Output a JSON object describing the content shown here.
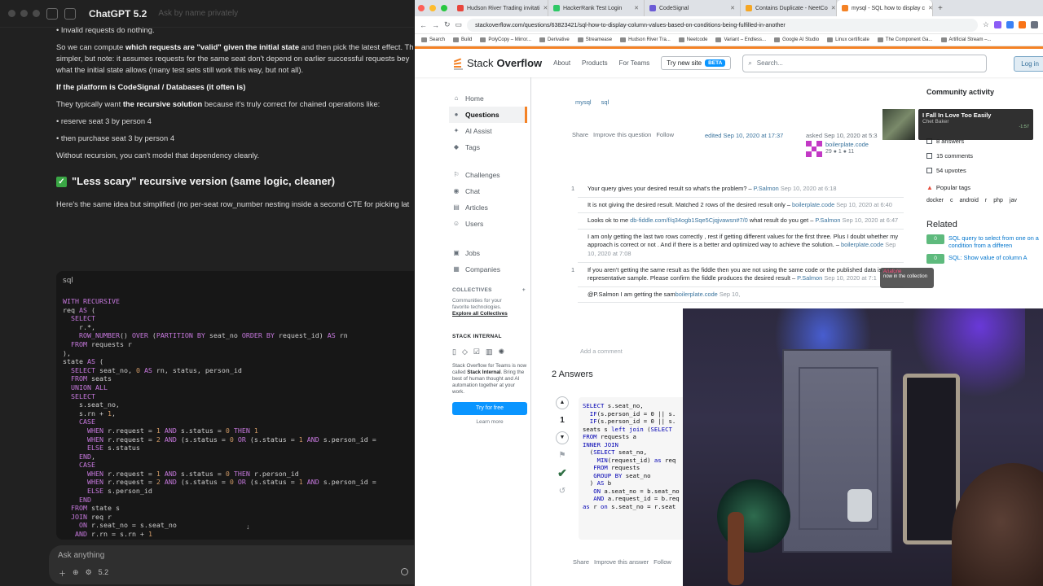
{
  "chat": {
    "model": "ChatGPT 5.2",
    "model_sub": "Ask by name privately",
    "lines": [
      {
        "html": "• Invalid requests do nothing."
      },
      {
        "html": ""
      },
      {
        "html": "So we can compute <b>which requests are \"valid\" given the initial state</b> and then pick the latest effect. Th"
      },
      {
        "html": "simpler, but note: it assumes requests for the same seat don't depend on earlier successful requests bey"
      },
      {
        "html": "what the initial state allows (many test sets still work this way, but not all)."
      },
      {
        "html": ""
      },
      {
        "html": "<b>If the platform is CodeSignal / Databases (it often is)</b>"
      },
      {
        "html": ""
      },
      {
        "html": "They typically want <b>the recursive solution</b> because it's truly correct for chained operations like:"
      },
      {
        "html": ""
      },
      {
        "html": "• reserve seat 3 by person 4"
      },
      {
        "html": ""
      },
      {
        "html": "• then purchase seat 3 by person 4"
      },
      {
        "html": ""
      },
      {
        "html": "Without recursion, you can't model that dependency cleanly."
      }
    ],
    "heading": "\"Less scary\" recursive version (same logic, cleaner)",
    "intro": "Here's the same idea but simplified (no per-seat row_number nesting inside a second CTE for picking lat",
    "code_lang": "sql",
    "code": "WITH RECURSIVE\nreq AS (\n  SELECT\n    r.*,\n    ROW_NUMBER() OVER (PARTITION BY seat_no ORDER BY request_id) AS rn\n  FROM requests r\n),\nstate AS (\n  SELECT seat_no, 0 AS rn, status, person_id\n  FROM seats\n  UNION ALL\n  SELECT\n    s.seat_no,\n    s.rn + 1,\n    CASE\n      WHEN r.request = 1 AND s.status = 0 THEN 1\n      WHEN r.request = 2 AND (s.status = 0 OR (s.status = 1 AND s.person_id =\n      ELSE s.status\n    END,\n    CASE\n      WHEN r.request = 1 AND s.status = 0 THEN r.person_id\n      WHEN r.request = 2 AND (s.status = 0 OR (s.status = 1 AND s.person_id =\n      ELSE s.person_id\n    END\n  FROM state s\n  JOIN req r\n    ON r.seat_no = s.seat_no\n   AND r.rn = s.rn + 1\n)",
    "ask_placeholder": "Ask anything",
    "ask_model": "5.2"
  },
  "browser": {
    "tabs": [
      {
        "label": "Hudson River Trading invitati",
        "color": "#e8453c",
        "active": false
      },
      {
        "label": "HackerRank Test Login",
        "color": "#2ec866",
        "active": false
      },
      {
        "label": "CodeSignal",
        "color": "#6b5bd6",
        "active": false
      },
      {
        "label": "Contains Duplicate - NeetCo",
        "color": "#f5a623",
        "active": false
      },
      {
        "label": "mysql - SQL how to display c",
        "color": "#f48225",
        "active": true
      }
    ],
    "url": "stackoverflow.com/questions/63823421/sql-how-to-display-column-values-based-on-conditions-being-fulfilled-in-another",
    "bookmarks": [
      "Search",
      "Build",
      "PolyCopy – Mirror...",
      "Derivative",
      "Streamease",
      "Hudson River Tra...",
      "Neetcode",
      "Variant – Endless...",
      "Google AI Studio",
      "Linux certificate",
      "The Component Ga...",
      "Artificial Stream –..."
    ]
  },
  "so": {
    "logo_a": "Stack",
    "logo_b": "Overflow",
    "nav": [
      "About",
      "Products",
      "For Teams"
    ],
    "try_new": "Try new site",
    "beta": "BETA",
    "search_placeholder": "Search...",
    "login": "Log in",
    "left_nav": [
      {
        "label": "Home",
        "icon": "⌂",
        "active": false
      },
      {
        "label": "Questions",
        "icon": "●",
        "active": true
      },
      {
        "label": "AI Assist",
        "icon": "✦",
        "active": false
      },
      {
        "label": "Tags",
        "icon": "◆",
        "active": false
      }
    ],
    "left_nav2": [
      {
        "label": "Challenges",
        "icon": "⚐"
      },
      {
        "label": "Chat",
        "icon": "◉"
      },
      {
        "label": "Articles",
        "icon": "▤"
      },
      {
        "label": "Users",
        "icon": "☺"
      }
    ],
    "left_nav3": [
      {
        "label": "Jobs",
        "icon": "▣"
      },
      {
        "label": "Companies",
        "icon": "▦"
      }
    ],
    "collectives": "COLLECTIVES",
    "collectives_desc": "Communities for your favorite technologies.",
    "explore": "Explore all Collectives",
    "so_internal": "STACK INTERNAL",
    "so_internal_desc_a": "Stack Overflow for Teams is now called ",
    "so_internal_desc_b": "Stack Internal",
    "so_internal_desc_c": ". Bring the best of human thought and AI automation together at your work.",
    "try_free": "Try for free",
    "learn_more": "Learn more",
    "tags": [
      "mysql",
      "sql"
    ],
    "post_menu": [
      "Share",
      "Improve this question",
      "Follow"
    ],
    "edited": "edited Sep 10, 2020 at 17:37",
    "asked": "asked Sep 10, 2020 at 5:3",
    "asker": "boilerplate.code",
    "asker_rep": "29 ● 1 ● 11",
    "comments": [
      {
        "score": "1",
        "text": "Your query gives your desired result so what's the problem? – ",
        "user": "P.Salmon",
        "date": " Sep 10, 2020 at 6:18"
      },
      {
        "score": "",
        "text": "It is not giving the desired result. Matched 2 rows of the desired result only – ",
        "user": "boilerplate.code",
        "date": " Sep 10, 2020 at 6:40"
      },
      {
        "score": "",
        "text": "Looks ok to me ",
        "link": "db-fiddle.com/f/q34ogb1Sqe5Cjqjvawsn#7/0",
        "text2": " what result do you get – ",
        "user": "P.Salmon",
        "date": " Sep 10, 2020 at 6:47"
      },
      {
        "score": "",
        "text": "I am only getting the last two rows correctly , rest if getting different values for the first three. Plus I doubt whether my approach is correct or not . And if there is a better and optimized way to achieve the solution. – ",
        "user": "boilerplate.code",
        "date": " Sep 10, 2020 at 7:08"
      },
      {
        "score": "1",
        "text": "If you aren't getting the same result as the fiddle then you are not using the same code or the published data is not a representative sample. Please confirm the fiddle produces the desired result – ",
        "user": "P.Salmon",
        "date": " Sep 10, 2020 at 7:1"
      },
      {
        "score": "",
        "text": "@P.Salmon I am getting the sam",
        "user": "boilerplate.code",
        "date": " Sep 10,"
      }
    ],
    "add_comment": "Add a comment",
    "answers_heading": "2 Answers",
    "answer_score": "1",
    "answer_code": "SELECT s.seat_no,\n  IF(s.person_id = 0 || s.\n  IF(s.person_id = 0 || s.\nseats s left join (SELECT\nFROM requests a\nINNER JOIN\n  (SELECT seat_no,\n    MIN(request_id) as req\n   FROM requests\n   GROUP BY seat_no\n  ) AS b\n   ON a.seat_no = b.seat_no\n   AND a.request_id = b.req\nas r on s.seat_no = r.seat",
    "answer_menu": [
      "Share",
      "Improve this answer",
      "Follow"
    ],
    "community": "Community activity",
    "stats": [
      "8 answers",
      "15 comments",
      "54 upvotes"
    ],
    "popular_tags": "Popular tags",
    "pop_tags": [
      "docker",
      "c",
      "android",
      "r",
      "php",
      "jav"
    ],
    "related": "Related",
    "related_items": [
      {
        "score": "0",
        "title": "SQL query to select from one on a condition from a differen"
      },
      {
        "score": "0",
        "title": "SQL: Show value of column A"
      }
    ]
  },
  "overlay": {
    "song": "I Fall In Love Too Easily",
    "artist": "Chet Baker",
    "time": "-1:57",
    "ariatone": "Ariatone",
    "ariatone_sub": "now in the collection"
  }
}
